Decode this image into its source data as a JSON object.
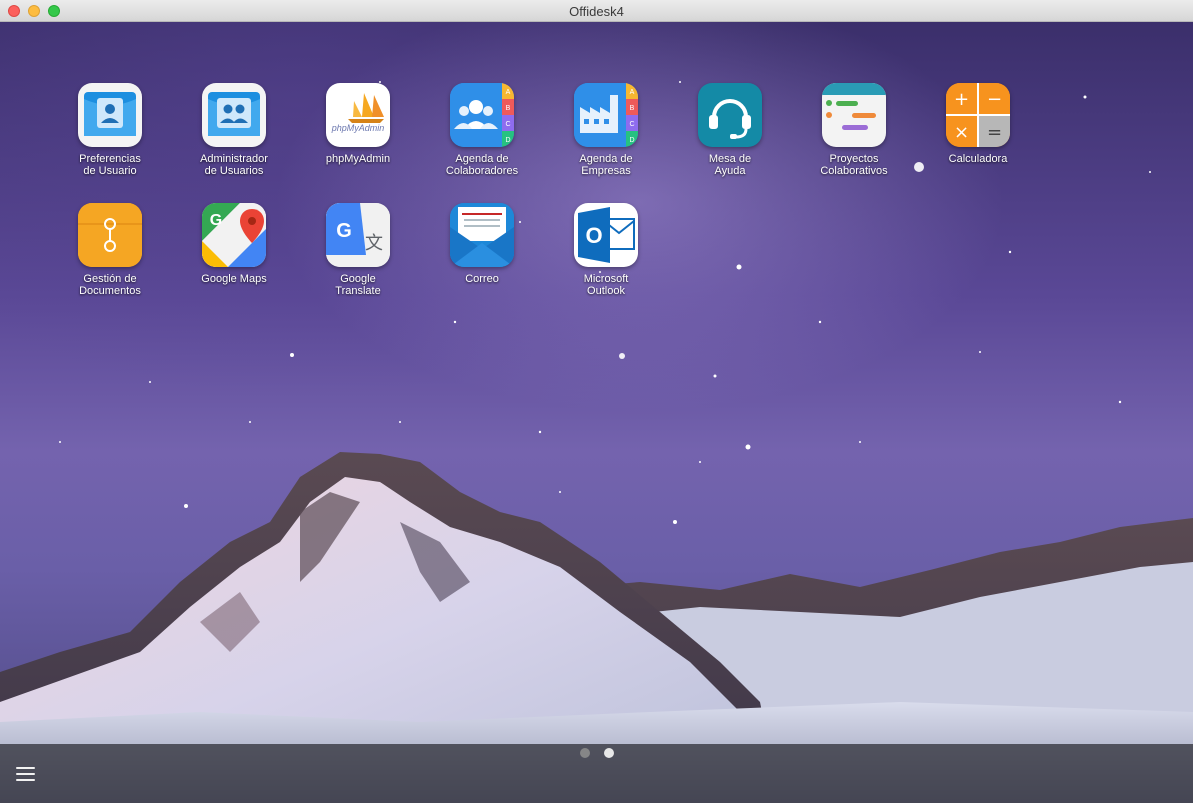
{
  "window": {
    "title": "Offidesk4"
  },
  "apps": [
    {
      "label": "Preferencias\nde Usuario",
      "icon": "user-card-icon"
    },
    {
      "label": "Administrador\nde Usuarios",
      "icon": "users-card-icon"
    },
    {
      "label": "phpMyAdmin",
      "icon": "phpmyadmin-icon"
    },
    {
      "label": "Agenda de\nColaboradores",
      "icon": "contacts-book-icon"
    },
    {
      "label": "Agenda de\nEmpresas",
      "icon": "factory-book-icon"
    },
    {
      "label": "Mesa de\nAyuda",
      "icon": "headset-icon"
    },
    {
      "label": "Proyectos\nColaborativos",
      "icon": "gantt-icon"
    },
    {
      "label": "Calculadora",
      "icon": "calculator-icon"
    },
    {
      "label": "Gestión de\nDocumentos",
      "icon": "folder-icon"
    },
    {
      "label": "Google Maps",
      "icon": "google-maps-icon"
    },
    {
      "label": "Google\nTranslate",
      "icon": "google-translate-icon"
    },
    {
      "label": "Correo",
      "icon": "mail-icon"
    },
    {
      "label": "Microsoft\nOutlook",
      "icon": "outlook-icon"
    }
  ],
  "icon_text": {
    "phpmyadmin": "phpMyAdmin",
    "tabs": [
      "A",
      "B",
      "C",
      "D"
    ],
    "calc": [
      "+",
      "−",
      "×",
      "="
    ],
    "translate": [
      "G",
      "文"
    ],
    "outlook": "O",
    "maps": "G"
  },
  "pager": {
    "pages": 2,
    "current": 2
  },
  "colors": {
    "dock": "#2a2a30",
    "accent_blue": "#2d8fdc"
  }
}
